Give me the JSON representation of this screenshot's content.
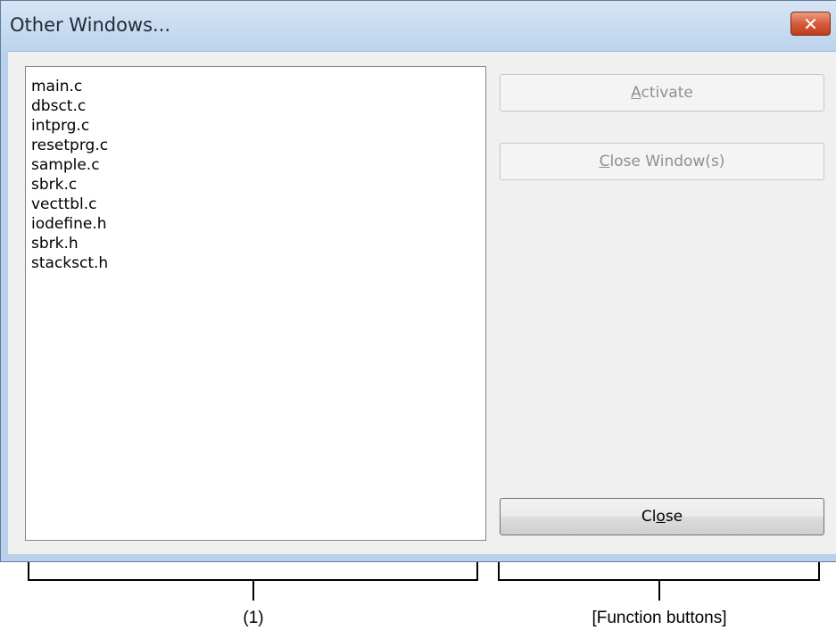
{
  "dialog": {
    "title": "Other Windows...",
    "close_icon": "close-icon",
    "close_glyph": "✕"
  },
  "window_list": {
    "items": [
      "main.c",
      "dbsct.c",
      "intprg.c",
      "resetprg.c",
      "sample.c",
      "sbrk.c",
      "vecttbl.c",
      "iodefine.h",
      "sbrk.h",
      "stacksct.h"
    ]
  },
  "buttons": {
    "activate": {
      "pre": "",
      "mnemonic": "A",
      "post": "ctivate",
      "enabled": false
    },
    "close_windows": {
      "pre": "",
      "mnemonic": "C",
      "post": "lose Window(s)",
      "enabled": false
    },
    "close": {
      "pre": "Cl",
      "mnemonic": "o",
      "post": "se",
      "enabled": true
    }
  },
  "annotations": {
    "list_label": "(1)",
    "buttons_label": "[Function buttons]"
  },
  "colors": {
    "frame": "#b9d1ea",
    "title_close_button": "#c94a28",
    "client_bg": "#f0f0f0",
    "disabled_text": "#8f8f8f"
  }
}
